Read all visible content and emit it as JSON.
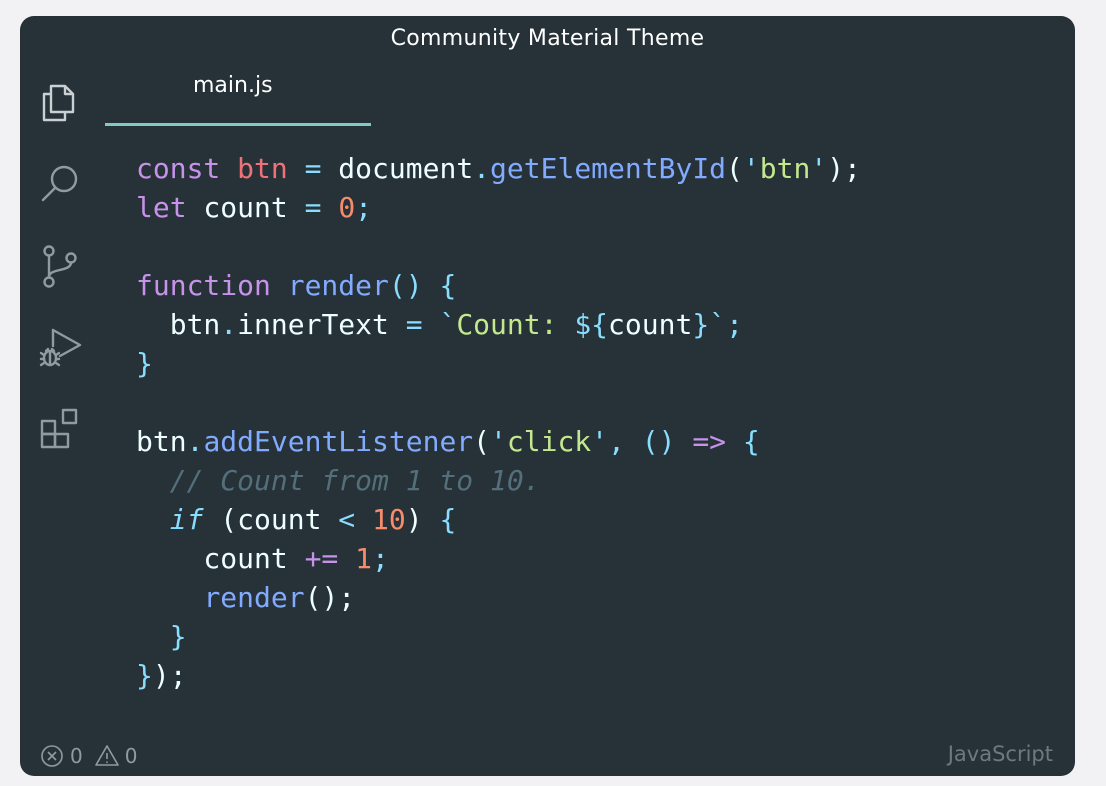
{
  "window": {
    "title": "Community Material Theme"
  },
  "tabs": [
    {
      "label": "main.js",
      "active": true
    }
  ],
  "activity_bar": {
    "icons": [
      "explorer-icon",
      "search-icon",
      "source-control-icon",
      "run-debug-icon",
      "extensions-icon"
    ]
  },
  "code": {
    "language": "JavaScript",
    "lines": [
      [
        {
          "t": "const",
          "c": "kw"
        },
        {
          "t": " ",
          "c": "plain"
        },
        {
          "t": "btn",
          "c": "var"
        },
        {
          "t": " ",
          "c": "plain"
        },
        {
          "t": "=",
          "c": "op"
        },
        {
          "t": " document",
          "c": "plain"
        },
        {
          "t": ".",
          "c": "punc"
        },
        {
          "t": "getElementById",
          "c": "fn"
        },
        {
          "t": "(",
          "c": "plain"
        },
        {
          "t": "'",
          "c": "punc"
        },
        {
          "t": "btn",
          "c": "str"
        },
        {
          "t": "'",
          "c": "punc"
        },
        {
          "t": ");",
          "c": "plain"
        }
      ],
      [
        {
          "t": "let",
          "c": "kw"
        },
        {
          "t": " count ",
          "c": "plain"
        },
        {
          "t": "=",
          "c": "op"
        },
        {
          "t": " ",
          "c": "plain"
        },
        {
          "t": "0",
          "c": "num"
        },
        {
          "t": ";",
          "c": "punc"
        }
      ],
      [],
      [
        {
          "t": "function",
          "c": "kw"
        },
        {
          "t": " ",
          "c": "plain"
        },
        {
          "t": "render",
          "c": "fn"
        },
        {
          "t": "()",
          "c": "punc"
        },
        {
          "t": " ",
          "c": "plain"
        },
        {
          "t": "{",
          "c": "punc"
        }
      ],
      [
        {
          "t": "  btn",
          "c": "plain"
        },
        {
          "t": ".",
          "c": "punc"
        },
        {
          "t": "innerText ",
          "c": "plain"
        },
        {
          "t": "=",
          "c": "op"
        },
        {
          "t": " ",
          "c": "plain"
        },
        {
          "t": "`",
          "c": "punc"
        },
        {
          "t": "Count: ",
          "c": "str"
        },
        {
          "t": "${",
          "c": "punc"
        },
        {
          "t": "count",
          "c": "plain"
        },
        {
          "t": "}",
          "c": "punc"
        },
        {
          "t": "`",
          "c": "punc"
        },
        {
          "t": ";",
          "c": "punc"
        }
      ],
      [
        {
          "t": "}",
          "c": "punc"
        }
      ],
      [],
      [
        {
          "t": "btn",
          "c": "plain"
        },
        {
          "t": ".",
          "c": "punc"
        },
        {
          "t": "addEventListener",
          "c": "fn"
        },
        {
          "t": "(",
          "c": "plain"
        },
        {
          "t": "'",
          "c": "punc"
        },
        {
          "t": "click",
          "c": "str"
        },
        {
          "t": "'",
          "c": "punc"
        },
        {
          "t": ", ",
          "c": "punc"
        },
        {
          "t": "()",
          "c": "punc"
        },
        {
          "t": " ",
          "c": "plain"
        },
        {
          "t": "=>",
          "c": "kw"
        },
        {
          "t": " ",
          "c": "plain"
        },
        {
          "t": "{",
          "c": "punc"
        }
      ],
      [
        {
          "t": "  // Count from 1 to 10.",
          "c": "cmt"
        }
      ],
      [
        {
          "t": "  ",
          "c": "plain"
        },
        {
          "t": "if",
          "c": "kwi"
        },
        {
          "t": " (count ",
          "c": "plain"
        },
        {
          "t": "<",
          "c": "op"
        },
        {
          "t": " ",
          "c": "plain"
        },
        {
          "t": "10",
          "c": "num"
        },
        {
          "t": ") ",
          "c": "plain"
        },
        {
          "t": "{",
          "c": "punc"
        }
      ],
      [
        {
          "t": "    count ",
          "c": "plain"
        },
        {
          "t": "+=",
          "c": "kw"
        },
        {
          "t": " ",
          "c": "plain"
        },
        {
          "t": "1",
          "c": "num"
        },
        {
          "t": ";",
          "c": "punc"
        }
      ],
      [
        {
          "t": "    ",
          "c": "plain"
        },
        {
          "t": "render",
          "c": "fn"
        },
        {
          "t": "();",
          "c": "plain"
        }
      ],
      [
        {
          "t": "  }",
          "c": "punc"
        }
      ],
      [
        {
          "t": "}",
          "c": "punc"
        },
        {
          "t": ");",
          "c": "plain"
        }
      ]
    ]
  },
  "status_bar": {
    "errors": "0",
    "warnings": "0",
    "language": "JavaScript"
  },
  "colors": {
    "background": "#263238",
    "accent": "#80cbc4",
    "keyword": "#c792ea",
    "function": "#82aaff",
    "string": "#c3e88d",
    "number": "#f78c6c",
    "variable": "#f07178",
    "punctuation": "#89ddff",
    "comment": "#546e7a"
  }
}
